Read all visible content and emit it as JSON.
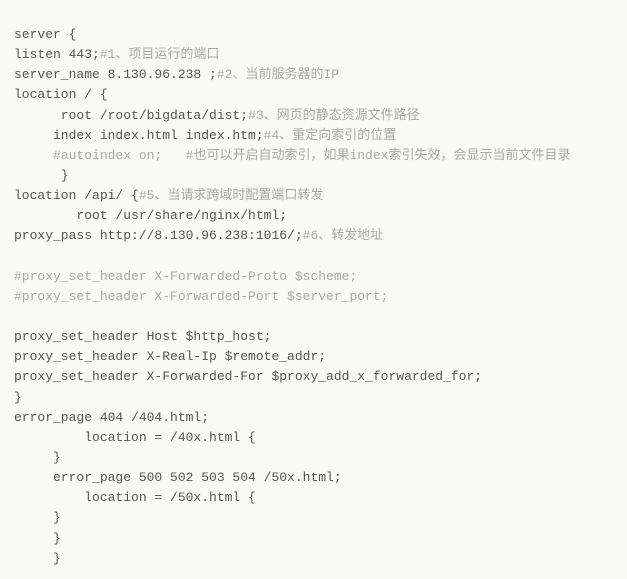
{
  "lines": [
    {
      "segments": [
        {
          "kind": "tok",
          "text": "server {"
        }
      ]
    },
    {
      "segments": [
        {
          "kind": "tok",
          "text": "listen 443;"
        },
        {
          "kind": "cmt",
          "text": "#1、项目运行的端口"
        }
      ]
    },
    {
      "segments": [
        {
          "kind": "tok",
          "text": "server_name 8.130.96.238 ;"
        },
        {
          "kind": "cmt",
          "text": "#2、当前服务器的IP"
        }
      ]
    },
    {
      "segments": [
        {
          "kind": "tok",
          "text": "location / {"
        }
      ]
    },
    {
      "segments": [
        {
          "kind": "tok",
          "text": "      root /root/bigdata/dist;"
        },
        {
          "kind": "cmt",
          "text": "#3、网页的静态资源文件路径"
        }
      ]
    },
    {
      "segments": [
        {
          "kind": "tok",
          "text": "     index index.html index.htm;"
        },
        {
          "kind": "cmt",
          "text": "#4、重定向索引的位置"
        }
      ]
    },
    {
      "segments": [
        {
          "kind": "tok",
          "text": "     "
        },
        {
          "kind": "cmt",
          "text": "#autoindex on;   #也可以开启自动索引，如果index索引失效，会显示当前文件目录"
        }
      ]
    },
    {
      "segments": [
        {
          "kind": "tok",
          "text": "      }"
        }
      ]
    },
    {
      "segments": [
        {
          "kind": "tok",
          "text": "location /api/ {"
        },
        {
          "kind": "cmt",
          "text": "#5、当请求跨域时配置端口转发"
        }
      ]
    },
    {
      "segments": [
        {
          "kind": "tok",
          "text": "        root /usr/share/nginx/html;"
        }
      ]
    },
    {
      "segments": [
        {
          "kind": "tok",
          "text": "proxy_pass http://8.130.96.238:1016/;"
        },
        {
          "kind": "cmt",
          "text": "#6、转发地址"
        }
      ]
    },
    {
      "segments": [
        {
          "kind": "tok",
          "text": ""
        }
      ]
    },
    {
      "segments": [
        {
          "kind": "cmt",
          "text": "#proxy_set_header X-Forwarded-Proto $scheme;"
        }
      ]
    },
    {
      "segments": [
        {
          "kind": "cmt",
          "text": "#proxy_set_header X-Forwarded-Port $server_port;"
        }
      ]
    },
    {
      "segments": [
        {
          "kind": "tok",
          "text": ""
        }
      ]
    },
    {
      "segments": [
        {
          "kind": "tok",
          "text": "proxy_set_header Host $http_host;"
        }
      ]
    },
    {
      "segments": [
        {
          "kind": "tok",
          "text": "proxy_set_header X-Real-Ip $remote_addr;"
        }
      ]
    },
    {
      "segments": [
        {
          "kind": "tok",
          "text": "proxy_set_header X-Forwarded-For $proxy_add_x_forwarded_for;"
        }
      ]
    },
    {
      "segments": [
        {
          "kind": "tok",
          "text": "}"
        }
      ]
    },
    {
      "segments": [
        {
          "kind": "tok",
          "text": "error_page 404 /404.html;"
        }
      ]
    },
    {
      "segments": [
        {
          "kind": "tok",
          "text": "         location = /40x.html {"
        }
      ]
    },
    {
      "segments": [
        {
          "kind": "tok",
          "text": "     }"
        }
      ]
    },
    {
      "segments": [
        {
          "kind": "tok",
          "text": "     error_page 500 502 503 504 /50x.html;"
        }
      ]
    },
    {
      "segments": [
        {
          "kind": "tok",
          "text": "         location = /50x.html {"
        }
      ]
    },
    {
      "segments": [
        {
          "kind": "tok",
          "text": "     }"
        }
      ]
    },
    {
      "segments": [
        {
          "kind": "tok",
          "text": "     }"
        }
      ]
    },
    {
      "segments": [
        {
          "kind": "tok",
          "text": "     }"
        }
      ]
    }
  ]
}
